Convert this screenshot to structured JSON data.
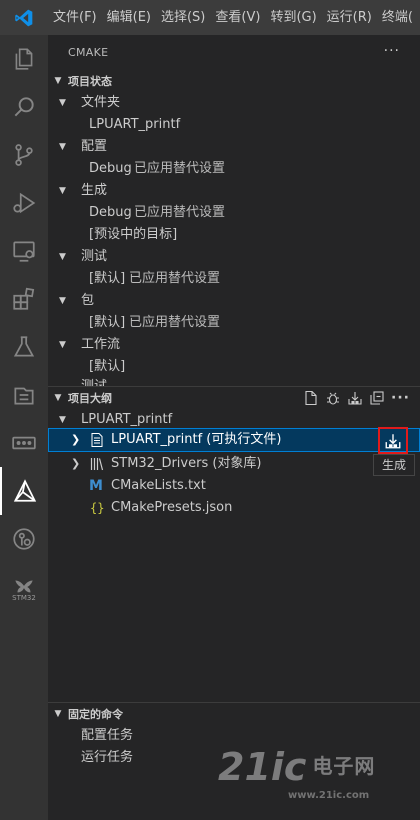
{
  "menubar": {
    "items": [
      "文件(F)",
      "编辑(E)",
      "选择(S)",
      "查看(V)",
      "转到(G)",
      "运行(R)",
      "终端("
    ]
  },
  "activitybar": {
    "icons": [
      "explorer-icon",
      "search-icon",
      "source-control-icon",
      "run-debug-icon",
      "remote-explorer-icon",
      "extensions-icon",
      "testing-icon",
      "project-manager-icon",
      "serial-monitor-icon",
      "cmake-icon",
      "git-graph-icon",
      "stm32-icon"
    ],
    "stm32_label": "STM32"
  },
  "sidebar": {
    "title": "CMAKE",
    "more": "···",
    "project_status": {
      "title": "项目状态",
      "folder_label": "文件夹",
      "folder_value": "LPUART_printf",
      "config_label": "配置",
      "config_value": "Debug",
      "config_note": "已应用替代设置",
      "build_label": "生成",
      "build_value": "Debug",
      "build_note": "已应用替代设置",
      "build_target": "[预设中的目标]",
      "test_label": "测试",
      "test_value": "[默认]",
      "test_note": "已应用替代设置",
      "package_label": "包",
      "package_value": "[默认]",
      "package_note": "已应用替代设置",
      "workflow_label": "工作流",
      "workflow_value": "[默认]",
      "cut_label": "测试"
    },
    "project_outline": {
      "title": "项目大纲",
      "root": "LPUART_printf",
      "items": [
        {
          "label": "LPUART_printf (可执行文件)"
        },
        {
          "label": "STM32_Drivers (对象库)"
        },
        {
          "label": "CMakeLists.txt"
        },
        {
          "label": "CMakePresets.json"
        }
      ],
      "tooltip": "生成"
    },
    "pinned": {
      "title": "固定的命令",
      "items": [
        "配置任务",
        "运行任务"
      ]
    }
  },
  "watermark": {
    "big": "21ic",
    "cn": "电子网",
    "url": "www.21ic.com"
  },
  "colors": {
    "accent": "#007fd4",
    "selection": "#04395e",
    "highlight_box": "#e01b1b",
    "cmake_blue": "#3e8ed0",
    "json_yellow": "#cbcb41"
  }
}
